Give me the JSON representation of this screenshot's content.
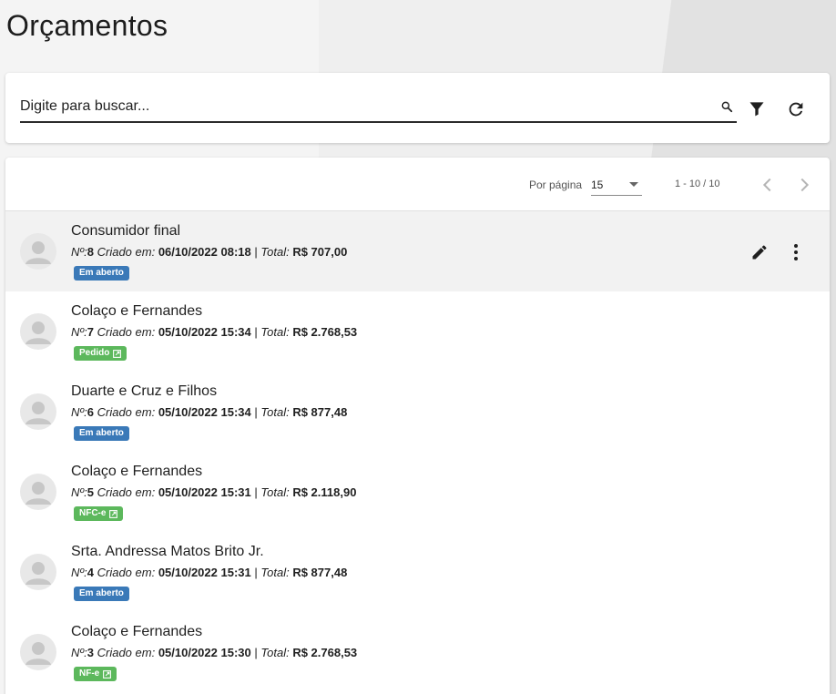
{
  "page": {
    "title": "Orçamentos"
  },
  "search": {
    "placeholder": "Digite para buscar..."
  },
  "paginator": {
    "per_page_label": "Por página",
    "per_page_value": "15",
    "range_label": "1 - 10 / 10"
  },
  "labels": {
    "number_prefix": "Nº:",
    "created_prefix": "Criado em:",
    "total_prefix": "Total:",
    "separator": "|"
  },
  "items": [
    {
      "name": "Consumidor final",
      "number": "8",
      "created": "06/10/2022 08:18",
      "total": "R$ 707,00",
      "status": "Em aberto",
      "status_kind": "open",
      "selected": true
    },
    {
      "name": "Colaço e Fernandes",
      "number": "7",
      "created": "05/10/2022 15:34",
      "total": "R$ 2.768,53",
      "status": "Pedido",
      "status_kind": "done",
      "selected": false
    },
    {
      "name": "Duarte e Cruz e Filhos",
      "number": "6",
      "created": "05/10/2022 15:34",
      "total": "R$ 877,48",
      "status": "Em aberto",
      "status_kind": "open",
      "selected": false
    },
    {
      "name": "Colaço e Fernandes",
      "number": "5",
      "created": "05/10/2022 15:31",
      "total": "R$ 2.118,90",
      "status": "NFC-e",
      "status_kind": "done",
      "selected": false
    },
    {
      "name": "Srta. Andressa Matos Brito Jr.",
      "number": "4",
      "created": "05/10/2022 15:31",
      "total": "R$ 877,48",
      "status": "Em aberto",
      "status_kind": "open",
      "selected": false
    },
    {
      "name": "Colaço e Fernandes",
      "number": "3",
      "created": "05/10/2022 15:30",
      "total": "R$ 2.768,53",
      "status": "NF-e",
      "status_kind": "done",
      "selected": false
    }
  ],
  "colors": {
    "status_open": "#3a79b8",
    "status_done": "#5cb85c",
    "selected_row": "#f2f2f2"
  },
  "icons": {
    "search": "search-icon",
    "filter": "filter-icon",
    "refresh": "refresh-icon",
    "prev": "chevron-left-icon",
    "next": "chevron-right-icon",
    "edit": "pencil-icon",
    "more": "more-vertical-icon",
    "avatar": "person-icon",
    "external": "external-link-icon"
  }
}
